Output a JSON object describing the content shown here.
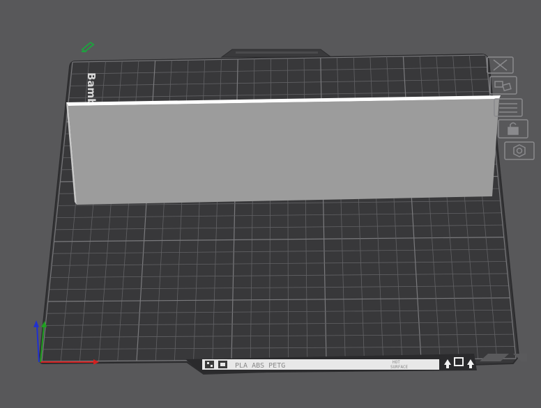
{
  "colors": {
    "background": "#58585a",
    "plate": "#38383a",
    "plate_edge": "#2f2f31",
    "grid": "#6a6a6d",
    "grid_major": "#7a7a7d",
    "object_face": "#9c9c9c",
    "object_top": "#ffffff",
    "object_side": "#c8c8c8",
    "axis_x": "#d42020",
    "axis_y": "#1fa020",
    "axis_z": "#2030d0",
    "toolbar_stroke": "#8a8a8d",
    "label_bg": "#e8e8e8",
    "label_text": "#7a7a7a"
  },
  "plate": {
    "brand_text": "Bambu",
    "label": {
      "materials": "PLA ABS PETG",
      "line1": "HOT",
      "line2": "SURFACE"
    }
  },
  "toolbar": {
    "items": [
      {
        "name": "close-button",
        "icon": "close-icon"
      },
      {
        "name": "arrange-button",
        "icon": "arrange-icon"
      },
      {
        "name": "orient-button",
        "icon": "orient-icon"
      },
      {
        "name": "lock-button",
        "icon": "lock-icon"
      },
      {
        "name": "settings-button",
        "icon": "gear-icon"
      }
    ]
  },
  "icons": {
    "edit_plate": "pencil-icon",
    "axes": "xyz-axes-icon"
  }
}
